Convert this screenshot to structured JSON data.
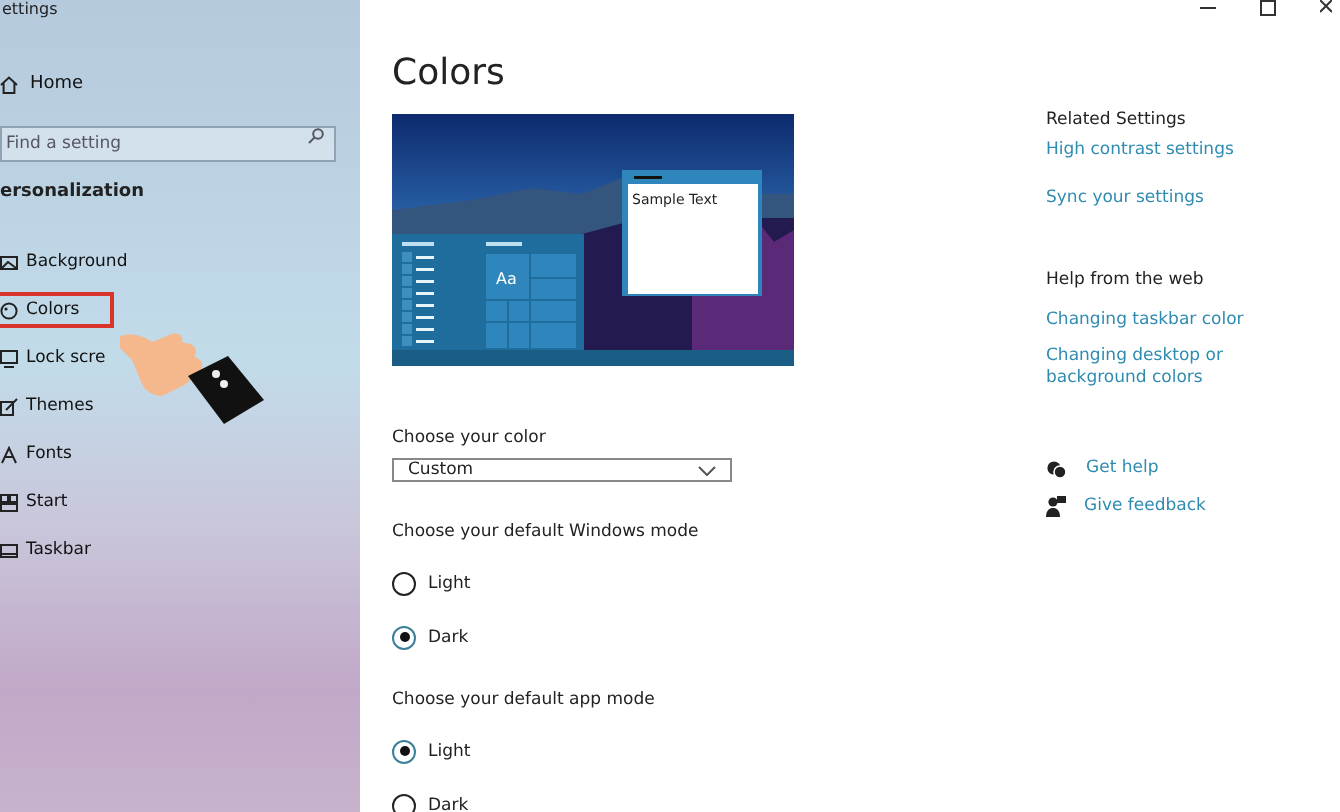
{
  "window": {
    "title": "ettings"
  },
  "sidebar": {
    "home": "Home",
    "search": {
      "placeholder": "Find a setting"
    },
    "section": "ersonalization",
    "items": [
      {
        "label": "Background",
        "selected": false
      },
      {
        "label": "Colors",
        "selected": true
      },
      {
        "label": "Lock scre",
        "selected": false
      },
      {
        "label": "Themes",
        "selected": false
      },
      {
        "label": "Fonts",
        "selected": false
      },
      {
        "label": "Start",
        "selected": false
      },
      {
        "label": "Taskbar",
        "selected": false
      }
    ]
  },
  "main": {
    "title": "Colors",
    "preview": {
      "tile_text": "Aa",
      "window_text": "Sample Text"
    },
    "color": {
      "label": "Choose your color",
      "value": "Custom"
    },
    "groups": [
      {
        "label": "Choose your default Windows mode",
        "options": [
          {
            "label": "Light",
            "selected": false
          },
          {
            "label": "Dark",
            "selected": true
          }
        ]
      },
      {
        "label": "Choose your default app mode",
        "options": [
          {
            "label": "Light",
            "selected": true
          },
          {
            "label": "Dark",
            "selected": false
          }
        ]
      }
    ]
  },
  "related": {
    "title": "Related Settings",
    "links": [
      "High contrast settings",
      "Sync your settings"
    ]
  },
  "help": {
    "title": "Help from the web",
    "links": [
      "Changing taskbar color",
      "Changing desktop or background colors"
    ]
  },
  "support": [
    "Get help",
    "Give feedback"
  ]
}
